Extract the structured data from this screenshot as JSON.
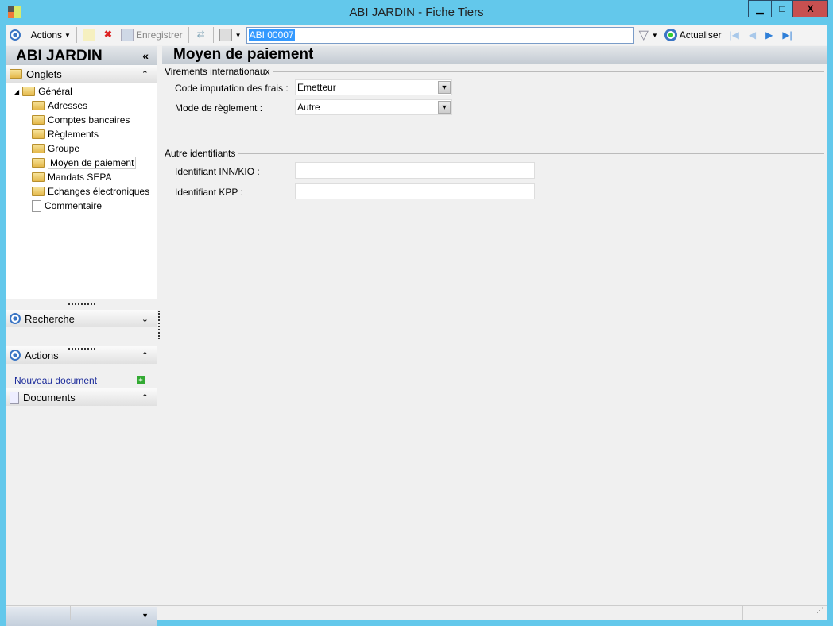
{
  "window": {
    "title": "ABI JARDIN -  Fiche Tiers",
    "minimize": "▁",
    "maximize": "□",
    "close": "X"
  },
  "toolbar": {
    "actions": "Actions",
    "save": "Enregistrer",
    "record": "ABI 00007",
    "refresh": "Actualiser"
  },
  "sidebar": {
    "title": "ABI JARDIN",
    "collapse": "«",
    "onglets": "Onglets",
    "tree_root": "Général",
    "tree_items": [
      "Adresses",
      "Comptes bancaires",
      "Règlements",
      "Groupe",
      "Moyen de paiement",
      "Mandats SEPA",
      "Echanges électroniques",
      "Commentaire"
    ],
    "recherche": "Recherche",
    "actions": "Actions",
    "documents": "Documents",
    "new_document": "Nouveau document"
  },
  "main": {
    "title": "Moyen de paiement",
    "group1": "Virements internationaux",
    "code_label": "Code imputation des frais :",
    "code_value": "Emetteur",
    "mode_label": "Mode de règlement :",
    "mode_value": "Autre",
    "group2": "Autre identifiants",
    "inn_label": "Identifiant INN/KIO :",
    "inn_value": "",
    "kpp_label": "Identifiant KPP :",
    "kpp_value": ""
  }
}
